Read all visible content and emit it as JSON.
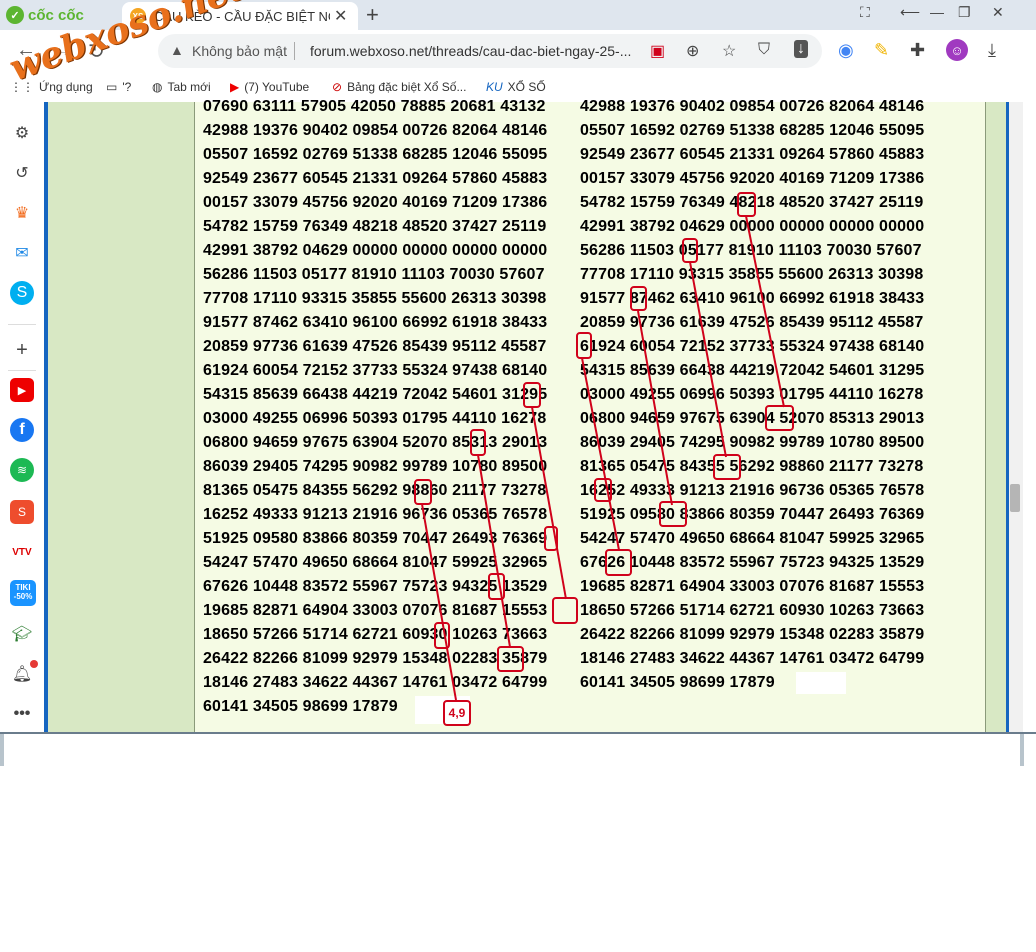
{
  "browser": {
    "brand": "cốc cốc",
    "tab": {
      "favicon": "XS",
      "title": "CẦU KÈO - CẦU ĐẶC BIỆT NGÀ"
    },
    "security_label": "Không bảo mật",
    "url": "forum.webxoso.net/threads/cau-dac-biet-ngay-25-..."
  },
  "bookmarks": [
    {
      "label": "Ứng dụng",
      "icon": "apps-icon"
    },
    {
      "label": "'?",
      "icon": "folder-icon"
    },
    {
      "label": "Tab mới",
      "icon": "globe-icon"
    },
    {
      "label": "(7) YouTube",
      "icon": "youtube-icon"
    },
    {
      "label": "Bảng đặc biệt Xổ Số...",
      "icon": "lottery-icon"
    },
    {
      "label": "XỔ SỐ",
      "icon": "xoso-icon"
    }
  ],
  "watermark": "webxoso.net",
  "sidebar_icons": [
    "settings-icon",
    "history-icon",
    "crown-icon",
    "messenger-icon",
    "skype-icon",
    "add-icon",
    "youtube-icon",
    "facebook-icon",
    "spotify-icon",
    "shopee-icon",
    "vtv-icon",
    "tiki-icon",
    "graduation-icon",
    "bell-icon",
    "more-icon"
  ],
  "tiki_label": "TIKI -50%",
  "grid": {
    "left": [
      "07690 63111 57905 42050 78885 20681 43132",
      "42988 19376 90402 09854 00726 82064 48146",
      "05507 16592 02769 51338 68285 12046 55095",
      "92549 23677 60545 21331 09264 57860 45883",
      "00157 33079 45756 92020 40169 71209 17386",
      "54782 15759 76349 48218 48520 37427 25119",
      "42991 38792 04629 00000 00000 00000 00000",
      "56286 11503 05177 81910 11103 70030 57607",
      "77708 17110 93315 35855 55600 26313 30398",
      "91577 87462 63410 96100 66992 61918 38433",
      "20859 97736 61639 47526 85439 95112 45587",
      "61924 60054 72152 37733 55324 97438 68140",
      "54315 85639 66438 44219 72042 54601 31295",
      "03000 49255 06996 50393 01795 44110 16278",
      "06800 94659 97675 63904 52070 85313 29013",
      "86039 29405 74295 90982 99789 10780 89500",
      "81365 05475 84355 56292 98860 21177 73278",
      "16252 49333 91213 21916 96736 05365 76578",
      "51925 09580 83866 80359 70447 26493 76369",
      "54247 57470 49650 68664 81047 59925 32965",
      "67626 10448 83572 55967 75723 94325 13529",
      "19685 82871 64904 33003 07076 81687 15553",
      "18650 57266 51714 62721 60930 10263 73663",
      "26422 82266 81099 92979 15348 02283 35879",
      "18146 27483 34622 44367 14761 03472 64799",
      "60141 34505 98699 17879"
    ],
    "right": [
      "42988 19376 90402 09854 00726 82064 48146",
      "05507 16592 02769 51338 68285 12046 55095",
      "92549 23677 60545 21331 09264 57860 45883",
      "00157 33079 45756 92020 40169 71209 17386",
      "54782 15759 76349 48218 48520 37427 25119",
      "42991 38792 04629 00000 00000 00000 00000",
      "56286 11503 05177 81910 11103 70030 57607",
      "77708 17110 93315 35855 55600 26313 30398",
      "91577 87462 63410 96100 66992 61918 38433",
      "20859 97736 61639 47526 85439 95112 45587",
      "61924 60054 72152 37733 55324 97438 68140",
      "54315 85639 66438 44219 72042 54601 31295",
      "03000 49255 06996 50393 01795 44110 16278",
      "06800 94659 97675 63904 52070 85313 29013",
      "86039 29405 74295 90982 99789 10780 89500",
      "81365 05475 84355 56292 98860 21177 73278",
      "16252 49333 91213 21916 96736 05365 76578",
      "51925 09580 83866 80359 70447 26493 76369",
      "54247 57470 49650 68664 81047 59925 32965",
      "67626 10448 83572 55967 75723 94325 13529",
      "19685 82871 64904 33003 07076 81687 15553",
      "18650 57266 51714 62721 60930 10263 73663",
      "26422 82266 81099 92979 15348 02283 35879",
      "18146 27483 34622 44367 14761 03472 64799",
      "60141 34505 98699 17879"
    ]
  },
  "annotation_label": "4,9",
  "annotation_color": "#d0021b"
}
